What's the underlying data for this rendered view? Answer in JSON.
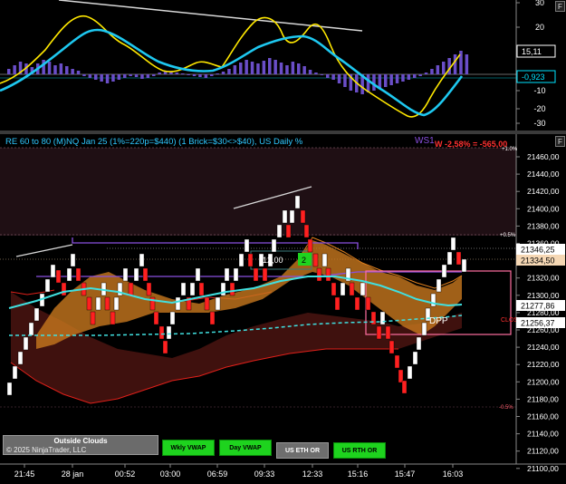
{
  "indicator_panel": {
    "y_axis_labels": [
      "30",
      "20",
      "10",
      "-10",
      "-20",
      "-30"
    ],
    "value_badges": [
      {
        "text": "15,11",
        "color": "#ffffff"
      },
      {
        "text": "-0,923",
        "color": "#00e5ff"
      }
    ]
  },
  "price_panel": {
    "title": "RE 60 to 80 (M)NQ Jan 25 (1%=220p=$440) (1 Brick=$30<>$40), US Daily %",
    "ws_label": "WS1",
    "w_label": "W -2,58% = -565,00",
    "pct_labels": [
      "+1.0%",
      "+0.5%",
      "-0.5%"
    ],
    "y_axis_labels": [
      "21460,00",
      "21440,00",
      "21420,00",
      "21400,00",
      "21380,00",
      "21360,00",
      "21340,00",
      "21320,00",
      "21300,00",
      "21280,00",
      "21260,00",
      "21240,00",
      "21220,00",
      "21200,00",
      "21180,00",
      "21160,00",
      "21140,00",
      "21120,00",
      "21100,00"
    ],
    "price_badges": [
      {
        "text": "21346,25",
        "bg": "#ffffff",
        "fg": "#000000"
      },
      {
        "text": "21334,50",
        "bg": "#f5d7b4",
        "fg": "#000000"
      },
      {
        "text": "21277,86",
        "bg": "#ffffff",
        "fg": "#000000"
      },
      {
        "text": "21256,37",
        "bg": "#ffffff",
        "fg": "#000000"
      }
    ],
    "box_label_left": "12,00",
    "box_label_right": "2",
    "dpp_label": "DPP",
    "clos_label": "CLOS"
  },
  "x_axis_labels": [
    "21:45",
    "28 jan",
    "00:52",
    "03:00",
    "06:59",
    "09:33",
    "12:33",
    "15:16",
    "15:47",
    "16:03"
  ],
  "buttons": {
    "outside_clouds_title": "Outside Clouds",
    "copyright": "© 2025 NinjaTrader, LLC",
    "wkly_vwap": "Wkly VWAP",
    "day_vwap": "Day VWAP",
    "us_eth_or": "US ETH OR",
    "us_rth_or": "US RTH OR"
  },
  "corner_tabs": [
    "F",
    "F"
  ],
  "colors": {
    "bull": "#ffffff",
    "bear": "#ff2020",
    "vwap": "#40e0e0",
    "cloud": "#c8781e",
    "purple": "#8a4fe0",
    "pink": "#ff6fa0"
  }
}
